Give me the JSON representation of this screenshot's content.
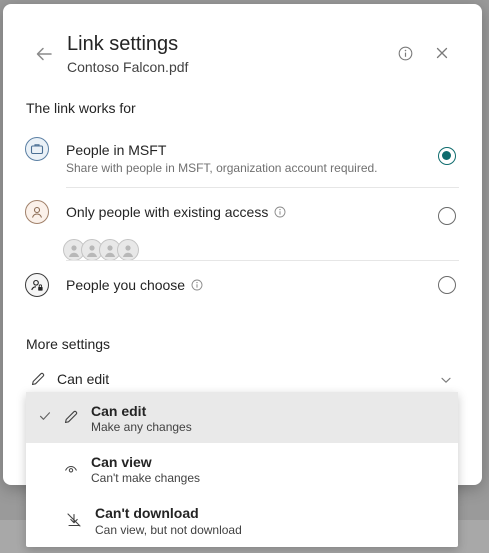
{
  "dialog": {
    "title": "Link settings",
    "file_name": "Contoso Falcon.pdf"
  },
  "link_works_for": {
    "label": "The link works for",
    "options": [
      {
        "title": "People in MSFT",
        "description": "Share with people in MSFT, organization account required.",
        "icon": "briefcase-icon",
        "selected": true
      },
      {
        "title": "Only people with existing access",
        "description": "",
        "icon": "person-icon",
        "selected": false,
        "has_info": true
      },
      {
        "title": "People you choose",
        "description": "",
        "icon": "person-lock-icon",
        "selected": false,
        "has_info": true
      }
    ]
  },
  "more_settings": {
    "label": "More settings",
    "permission": "Can edit"
  },
  "permission_menu": {
    "items": [
      {
        "title": "Can edit",
        "description": "Make any changes",
        "icon": "pencil-icon",
        "selected": true
      },
      {
        "title": "Can view",
        "description": "Can't make changes",
        "icon": "eye-icon",
        "selected": false
      },
      {
        "title": "Can't download",
        "description": "Can view, but not download",
        "icon": "no-download-icon",
        "selected": false
      }
    ]
  },
  "colors": {
    "accent": "#0f6c6e",
    "selected_row": "#e9e9e9"
  }
}
